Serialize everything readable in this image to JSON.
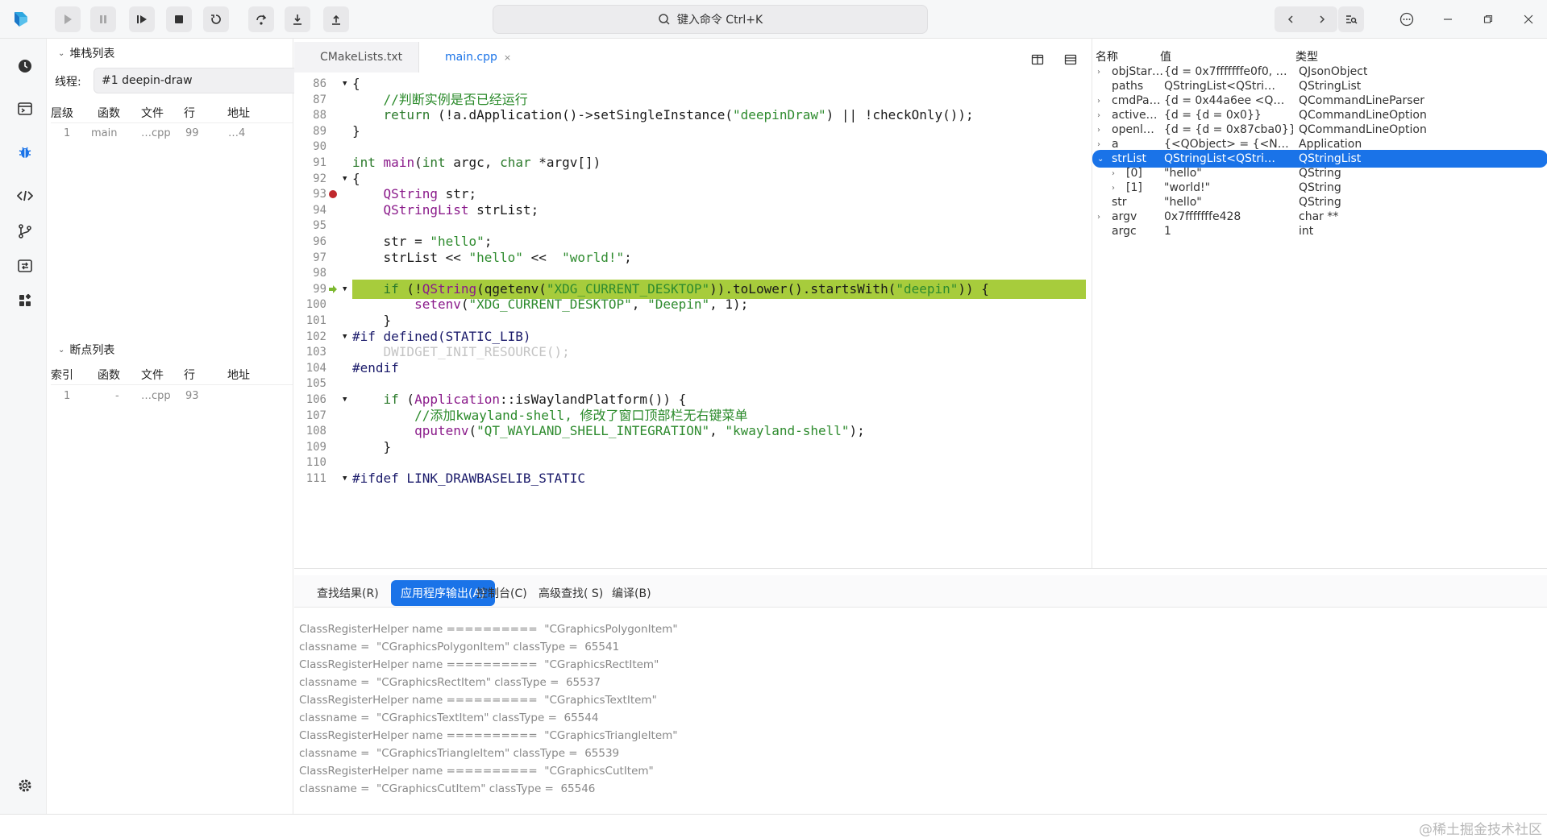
{
  "toolbar": {
    "buttons": [
      "continue-icon",
      "pause-icon",
      "step-continue-icon",
      "stop-icon",
      "restart-icon",
      "step-over-icon",
      "step-into-icon",
      "step-out-icon"
    ],
    "command_placeholder": "键入命令 Ctrl+K"
  },
  "rail": [
    "history-icon",
    "terminal-icon",
    "debug-icon",
    "code-icon",
    "git-icon",
    "switch-icon",
    "apps-icon",
    "settings-icon"
  ],
  "stack": {
    "title": "堆栈列表",
    "thread_label": "线程:",
    "thread_value": "#1 deepin-draw",
    "columns": [
      "层级",
      "函数",
      "文件",
      "行",
      "地址"
    ],
    "rows": [
      [
        "1",
        "main",
        "…cpp",
        "99",
        "…4"
      ]
    ]
  },
  "breakpoints": {
    "title": "断点列表",
    "columns": [
      "索引",
      "函数",
      "文件",
      "行",
      "地址"
    ],
    "rows": [
      [
        "1",
        "-",
        "…cpp",
        "93",
        ""
      ]
    ]
  },
  "editor": {
    "tabs": [
      {
        "label": "CMakeLists.txt"
      },
      {
        "label": "main.cpp",
        "close": "×"
      }
    ],
    "current_line": 99,
    "breakpoint_line": 93,
    "lines": [
      {
        "n": "86",
        "fold": true,
        "html": "{"
      },
      {
        "n": "87",
        "html": "    <span class=\"cm\">//判断实例是否已经运行</span>"
      },
      {
        "n": "88",
        "html": "    <span class=\"kw\">return</span> (!a.dApplication()->setSingleInstance(<span class=\"str\">\"deepinDraw\"</span>) || !checkOnly());"
      },
      {
        "n": "89",
        "html": "}"
      },
      {
        "n": "90",
        "html": ""
      },
      {
        "n": "91",
        "html": "<span class=\"kw\">int</span> <span class=\"kt\">main</span>(<span class=\"kw\">int</span> argc, <span class=\"kw\">char</span> *argv[])"
      },
      {
        "n": "92",
        "fold": true,
        "html": "{"
      },
      {
        "n": "93",
        "bp": true,
        "html": "    <span class=\"kt\">QString</span> str;"
      },
      {
        "n": "94",
        "html": "    <span class=\"kt\">QStringList</span> strList;"
      },
      {
        "n": "95",
        "html": ""
      },
      {
        "n": "96",
        "html": "    str = <span class=\"str\">\"hello\"</span>;"
      },
      {
        "n": "97",
        "html": "    strList << <span class=\"str\">\"hello\"</span> <<  <span class=\"str\">\"world!\"</span>;"
      },
      {
        "n": "98",
        "html": ""
      },
      {
        "n": "99",
        "cur": true,
        "fold": true,
        "html": "    <span class=\"kw\">if</span> (!<span class=\"kt\">QString</span>(qgetenv(<span class=\"str\">\"XDG_CURRENT_DESKTOP\"</span>)).toLower().startsWith(<span class=\"str\">\"deepin\"</span>)) {"
      },
      {
        "n": "100",
        "html": "        <span class=\"kt\">setenv</span>(<span class=\"str\">\"XDG_CURRENT_DESKTOP\"</span>, <span class=\"str\">\"Deepin\"</span>, 1);"
      },
      {
        "n": "101",
        "html": "    }"
      },
      {
        "n": "102",
        "fold": true,
        "html": "<span class=\"pp\">#if defined(STATIC_LIB)</span>"
      },
      {
        "n": "103",
        "html": "    <span class=\"gray\">DWIDGET_INIT_RESOURCE();</span>"
      },
      {
        "n": "104",
        "html": "<span class=\"pp\">#endif</span>"
      },
      {
        "n": "105",
        "html": ""
      },
      {
        "n": "106",
        "fold": true,
        "html": "    <span class=\"kw\">if</span> (<span class=\"kt\">Application</span>::isWaylandPlatform()) {"
      },
      {
        "n": "107",
        "html": "        <span class=\"cm\">//添加kwayland-shell, 修改了窗口顶部栏无右键菜单</span>"
      },
      {
        "n": "108",
        "html": "        <span class=\"kt\">qputenv</span>(<span class=\"str\">\"QT_WAYLAND_SHELL_INTEGRATION\"</span>, <span class=\"str\">\"kwayland-shell\"</span>);"
      },
      {
        "n": "109",
        "html": "    }"
      },
      {
        "n": "110",
        "html": ""
      },
      {
        "n": "111",
        "fold": true,
        "html": "<span class=\"pp\">#ifdef LINK_DRAWBASELIB_STATIC</span>"
      }
    ]
  },
  "variables": {
    "columns": [
      "名称",
      "值",
      "类型"
    ],
    "rows": [
      {
        "expand": "›",
        "indent": 0,
        "name": "objStar…",
        "value": "{d = 0x7fffffffe0f0, …",
        "type": "QJsonObject"
      },
      {
        "expand": "",
        "indent": 0,
        "name": "paths",
        "value": "QStringList<QStri…",
        "type": "QStringList"
      },
      {
        "expand": "›",
        "indent": 0,
        "name": "cmdPa…",
        "value": "{d = 0x44a6ee <Q…",
        "type": "QCommandLineParser"
      },
      {
        "expand": "›",
        "indent": 0,
        "name": "active…",
        "value": "{d = {d = 0x0}}",
        "type": "QCommandLineOption"
      },
      {
        "expand": "›",
        "indent": 0,
        "name": "openl…",
        "value": "{d = {d = 0x87cba0}}",
        "type": "QCommandLineOption"
      },
      {
        "expand": "›",
        "indent": 0,
        "name": "a",
        "value": "{<QObject> = {<N…",
        "type": "Application"
      },
      {
        "expand": "⌄",
        "indent": 0,
        "name": "strList",
        "value": "QStringList<QStri…",
        "type": "QStringList",
        "selected": true
      },
      {
        "expand": "›",
        "indent": 1,
        "name": "[0]",
        "value": "\"hello\"",
        "type": "QString"
      },
      {
        "expand": "›",
        "indent": 1,
        "name": "[1]",
        "value": "\"world!\"",
        "type": "QString"
      },
      {
        "expand": "",
        "indent": 0,
        "name": "str",
        "value": "\"hello\"",
        "type": "QString"
      },
      {
        "expand": "›",
        "indent": 0,
        "name": "argv",
        "value": "0x7fffffffe428",
        "type": "char **"
      },
      {
        "expand": "",
        "indent": 0,
        "name": "argc",
        "value": "1",
        "type": "int"
      }
    ]
  },
  "output": {
    "tabs": [
      {
        "label": "查找结果(R)"
      },
      {
        "label": "应用程序输出(A)",
        "active": true
      },
      {
        "label": "控制台(C)"
      },
      {
        "label": "高级查找( S)"
      },
      {
        "label": "编译(B)"
      }
    ],
    "lines": [
      "ClassRegisterHelper name ==========  \"CGraphicsPolygonItem\"",
      "classname =  \"CGraphicsPolygonItem\" classType =  65541",
      "ClassRegisterHelper name ==========  \"CGraphicsRectItem\"",
      "classname =  \"CGraphicsRectItem\" classType =  65537",
      "ClassRegisterHelper name ==========  \"CGraphicsTextItem\"",
      "classname =  \"CGraphicsTextItem\" classType =  65544",
      "ClassRegisterHelper name ==========  \"CGraphicsTriangleItem\"",
      "classname =  \"CGraphicsTriangleItem\" classType =  65539",
      "ClassRegisterHelper name ==========  \"CGraphicsCutItem\"",
      "classname =  \"CGraphicsCutItem\" classType =  65546"
    ]
  },
  "watermark": "@稀土掘金技术社区",
  "colors": {
    "accent": "#1a73e8",
    "current_line": "#a7cc3c",
    "breakpoint": "#c0282d"
  }
}
